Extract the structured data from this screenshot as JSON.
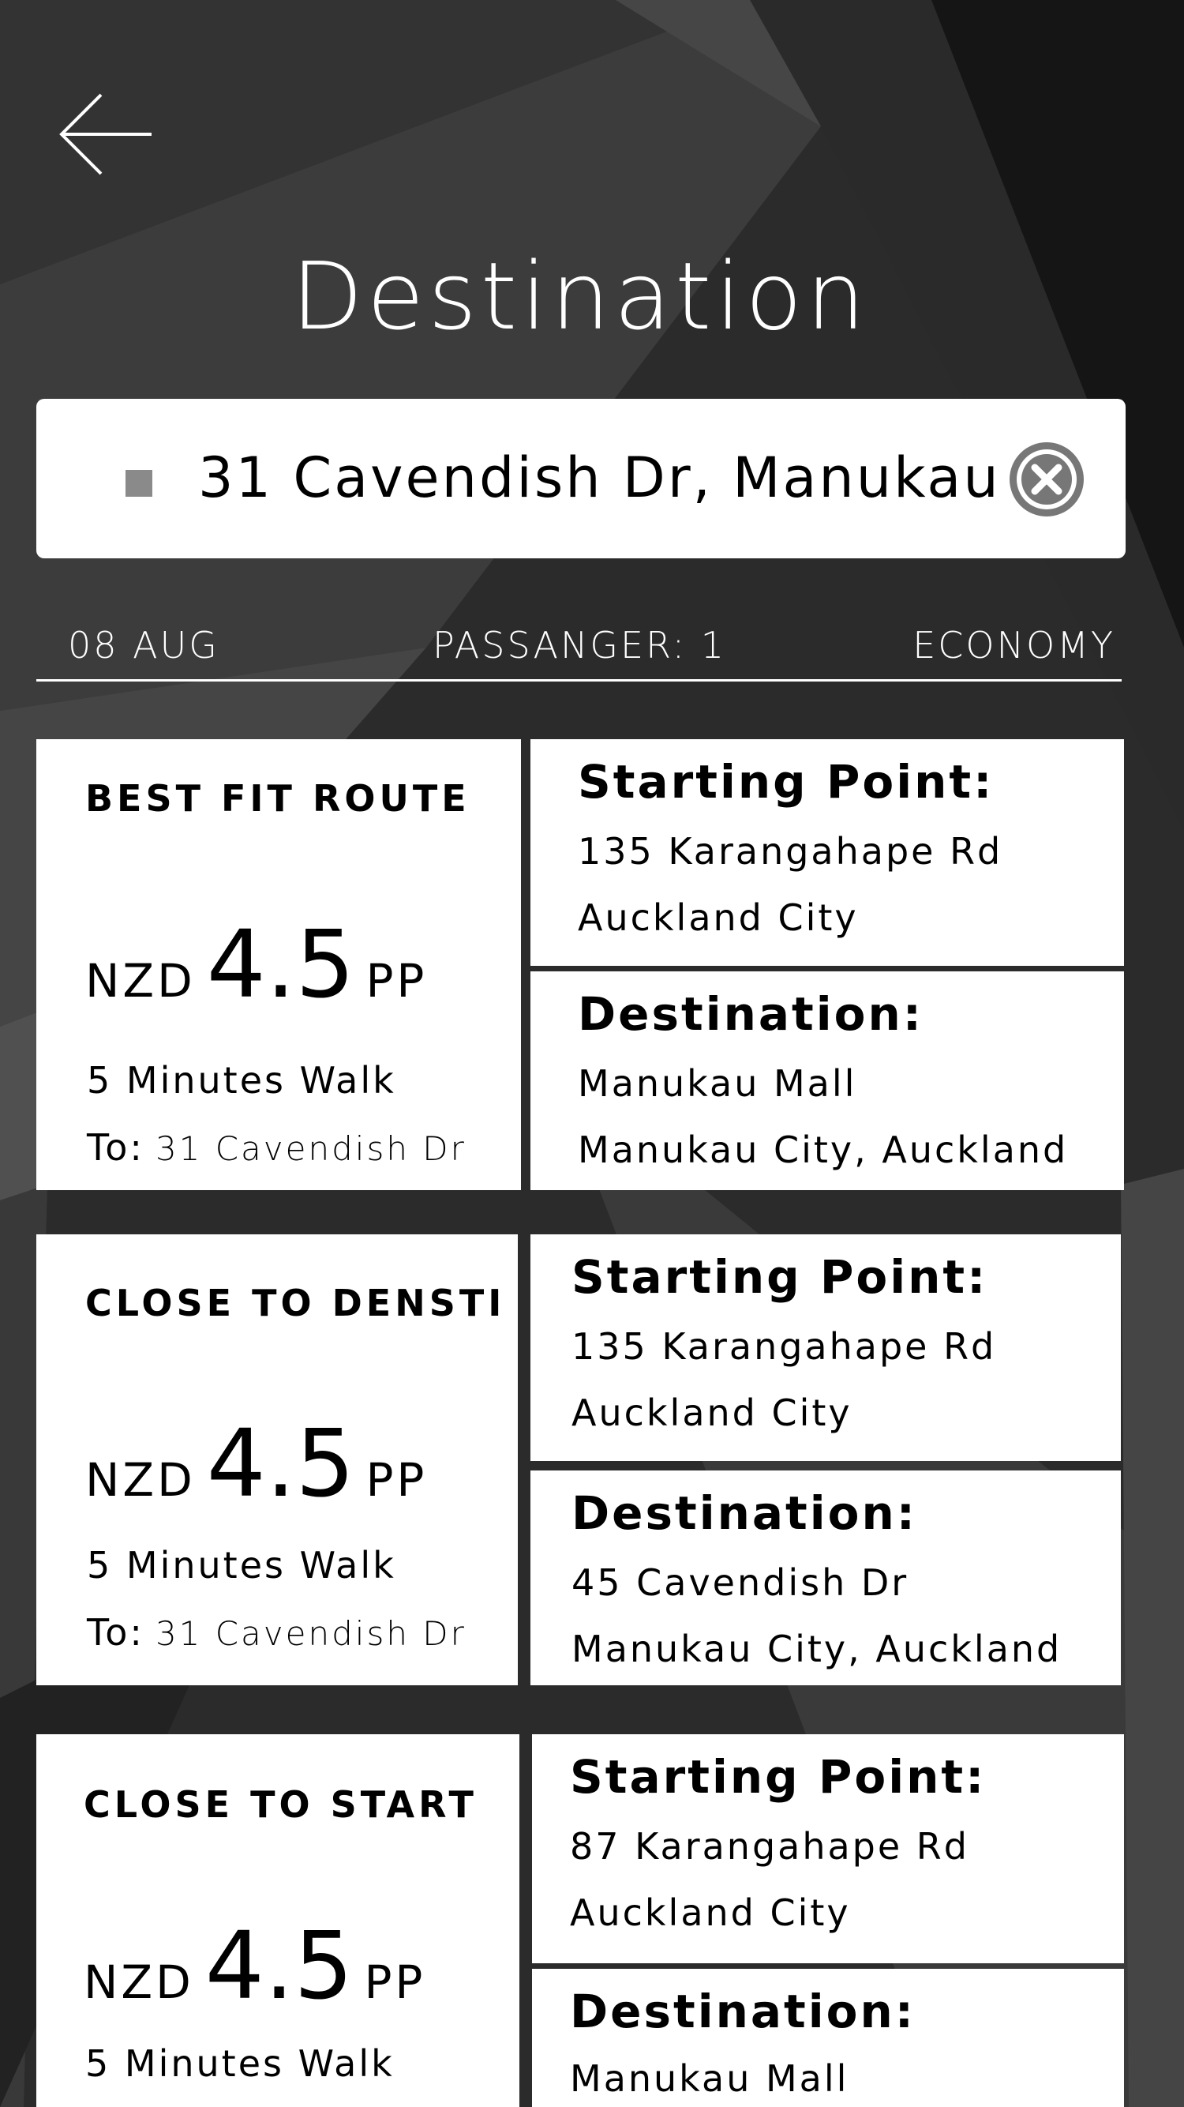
{
  "header": {
    "title": "Destination"
  },
  "search": {
    "value": "31 Cavendish Dr, Manukau,"
  },
  "trip_info": {
    "date": "08 AUG",
    "passengers": "PASSANGER: 1",
    "class": "ECONOMY"
  },
  "routes": [
    {
      "label": "BEST FIT ROUTE",
      "currency": "NZD",
      "price": "4.5",
      "unit": "PP",
      "walk": "5 Minutes Walk",
      "to_label": "To:",
      "to_address": "31 Cavendish Dr",
      "start_title": "Starting Point:",
      "start_line1": "135 Karangahape Rd",
      "start_line2": "Auckland City",
      "dest_title": "Destination:",
      "dest_line1": "Manukau Mall",
      "dest_line2": "Manukau City, Auckland"
    },
    {
      "label": "CLOSE TO DENSTI",
      "currency": "NZD",
      "price": "4.5",
      "unit": "PP",
      "walk": "5 Minutes Walk",
      "to_label": "To:",
      "to_address": "31 Cavendish Dr",
      "start_title": "Starting Point:",
      "start_line1": "135 Karangahape Rd",
      "start_line2": "Auckland City",
      "dest_title": "Destination:",
      "dest_line1": "45 Cavendish Dr",
      "dest_line2": "Manukau City, Auckland"
    },
    {
      "label": "CLOSE TO START",
      "currency": "NZD",
      "price": "4.5",
      "unit": "PP",
      "walk": "5 Minutes Walk",
      "start_title": "Starting Point:",
      "start_line1": "87 Karangahape Rd",
      "start_line2": "Auckland City",
      "dest_title": "Destination:",
      "dest_line1": "Manukau Mall"
    }
  ],
  "icons": {
    "back": "arrow-left-icon",
    "clear": "clear-circle-x-icon",
    "location": "square-marker-icon"
  },
  "colors": {
    "background": "#2c2c2c",
    "card": "#ffffff",
    "text_light": "#ffffff",
    "text_dark": "#000000",
    "marker": "#8a8a8a"
  }
}
